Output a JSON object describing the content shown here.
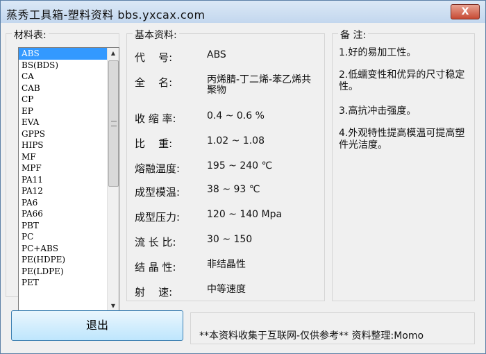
{
  "window": {
    "title": "蒸秀工具箱-塑料资料  bbs.yxcax.com",
    "close_label": "X"
  },
  "materials": {
    "title": "材料表:",
    "items": [
      "ABS",
      "BS(BDS)",
      "CA",
      "CAB",
      "CP",
      "EP",
      "EVA",
      "GPPS",
      "HIPS",
      "MF",
      "MPF",
      "PA11",
      "PA12",
      "PA6",
      "PA66",
      "PBT",
      "PC",
      "PC+ABS",
      "PE(HDPE)",
      "PE(LDPE)",
      "PET"
    ],
    "selected": "ABS"
  },
  "basic": {
    "title": "基本资料:",
    "rows": [
      {
        "label": "代    号:",
        "value": "ABS"
      },
      {
        "label": "全    名:",
        "value": "丙烯腈-丁二烯-苯乙烯共聚物"
      },
      {
        "label": "收 缩 率:",
        "value": "0.4 ~ 0.6 %"
      },
      {
        "label": "比    重:",
        "value": "1.02 ~ 1.08"
      },
      {
        "label": "熔融温度:",
        "value": "195 ~ 240 ℃"
      },
      {
        "label": "成型模温:",
        "value": "38 ~ 93 ℃"
      },
      {
        "label": "成型压力:",
        "value": "120 ~ 140 Mpa"
      },
      {
        "label": "流 长 比:",
        "value": "30 ~ 150"
      },
      {
        "label": "结 晶 性:",
        "value": "非结晶性"
      },
      {
        "label": "射    速:",
        "value": "中等速度"
      }
    ]
  },
  "notes": {
    "title": "备  注:",
    "items": [
      "1.好的易加工性。",
      "2.低蠕变性和优异的尺寸稳定性。",
      "3.高抗冲击强度。",
      "4.外观特性提高模温可提高塑件光洁度。"
    ]
  },
  "footer": {
    "exit_label": "退出",
    "disclaimer": "**本资料收集于互联网-仅供参考**   资料整理:Momo"
  }
}
